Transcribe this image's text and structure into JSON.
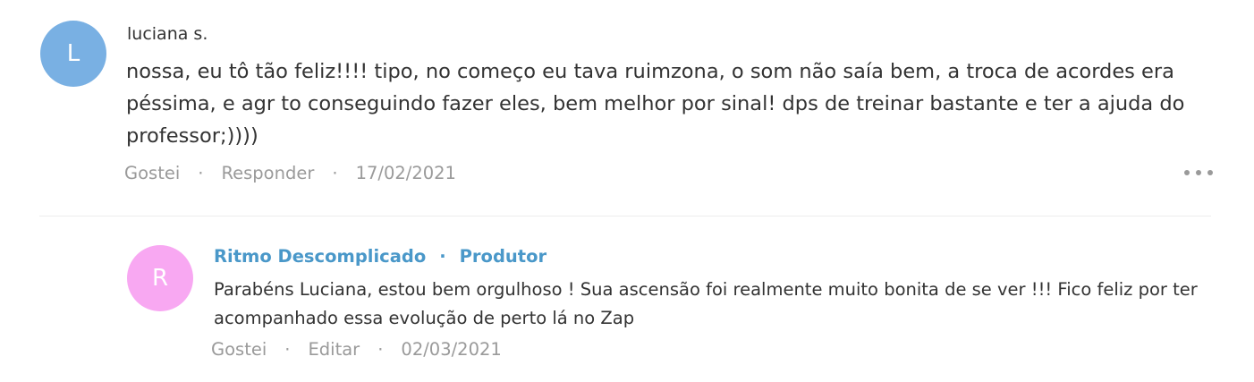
{
  "comment": {
    "avatar_letter": "L",
    "avatar_color": "#79b0e3",
    "author": "luciana s.",
    "text": "nossa, eu tô tão feliz!!!! tipo, no começo eu tava ruimzona, o som não saía bem, a troca de acordes era péssima, e agr to conseguindo fazer eles, bem melhor por sinal! dps de treinar bastante e ter a ajuda do professor;))))",
    "like_label": "Gostei",
    "reply_label": "Responder",
    "separator": "·",
    "date": "17/02/2021",
    "more_icon": "more-horizontal-icon"
  },
  "reply": {
    "avatar_letter": "R",
    "avatar_color": "#f8a8f2",
    "author": "Ritmo Descomplicado",
    "separator": "·",
    "role": "Produtor",
    "text": "Parabéns Luciana, estou bem orgulhoso ! Sua ascensão foi realmente muito bonita de se ver !!! Fico feliz por ter acompanhado essa evolução de perto lá no Zap",
    "like_label": "Gostei",
    "edit_label": "Editar",
    "date": "02/03/2021"
  },
  "colors": {
    "text": "#333333",
    "muted": "#9a9a9a",
    "producer_link": "#4a98c9",
    "divider": "#ececec"
  }
}
